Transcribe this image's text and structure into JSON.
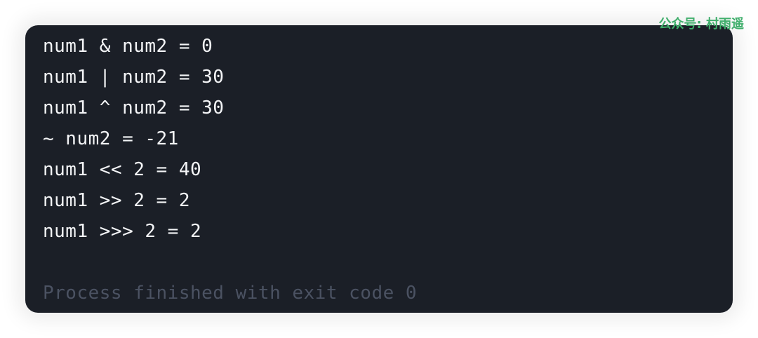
{
  "terminal": {
    "output_lines": [
      "num1 & num2 = 0",
      "num1 | num2 = 30",
      "num1 ^ num2 = 30",
      "~ num2 = -21",
      "num1 << 2 = 40",
      "num1 >> 2 = 2",
      "num1 >>> 2 = 2"
    ],
    "exit_message": "Process finished with exit code 0"
  },
  "watermark": {
    "text": "公众号: 村雨遥"
  },
  "colors": {
    "terminal_background": "#1b1f27",
    "output_text": "#f3f4f6",
    "exit_text": "#4b5262",
    "watermark": "#3fae6b"
  }
}
